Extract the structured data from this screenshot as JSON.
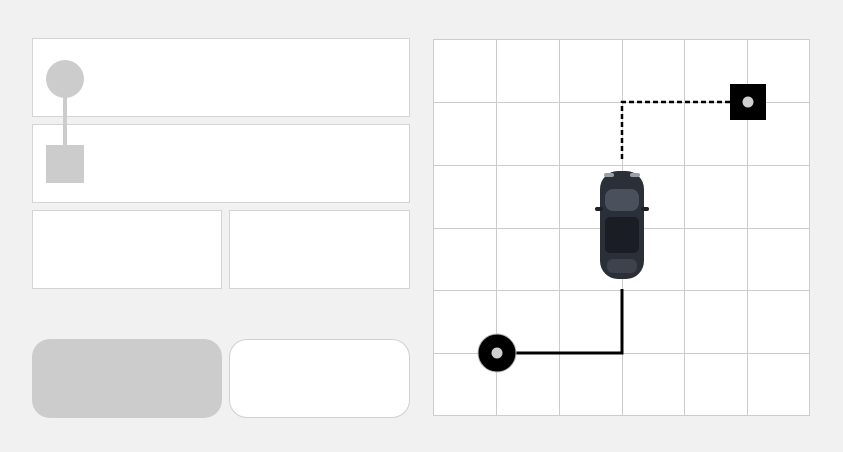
{
  "trip_form": {
    "origin_text": "",
    "destination_text": "",
    "field_left_text": "",
    "field_right_text": ""
  },
  "actions": {
    "primary_label": "",
    "secondary_label": ""
  },
  "map": {
    "grid_columns": 6,
    "grid_rows": 6,
    "origin_icon": "origin-pin-icon",
    "destination_icon": "destination-pin-icon",
    "vehicle_icon": "car-icon",
    "colors": {
      "grid_line": "#cccccc",
      "route": "#000000",
      "marker": "#000000",
      "vehicle_body": "#2b2f38"
    }
  }
}
